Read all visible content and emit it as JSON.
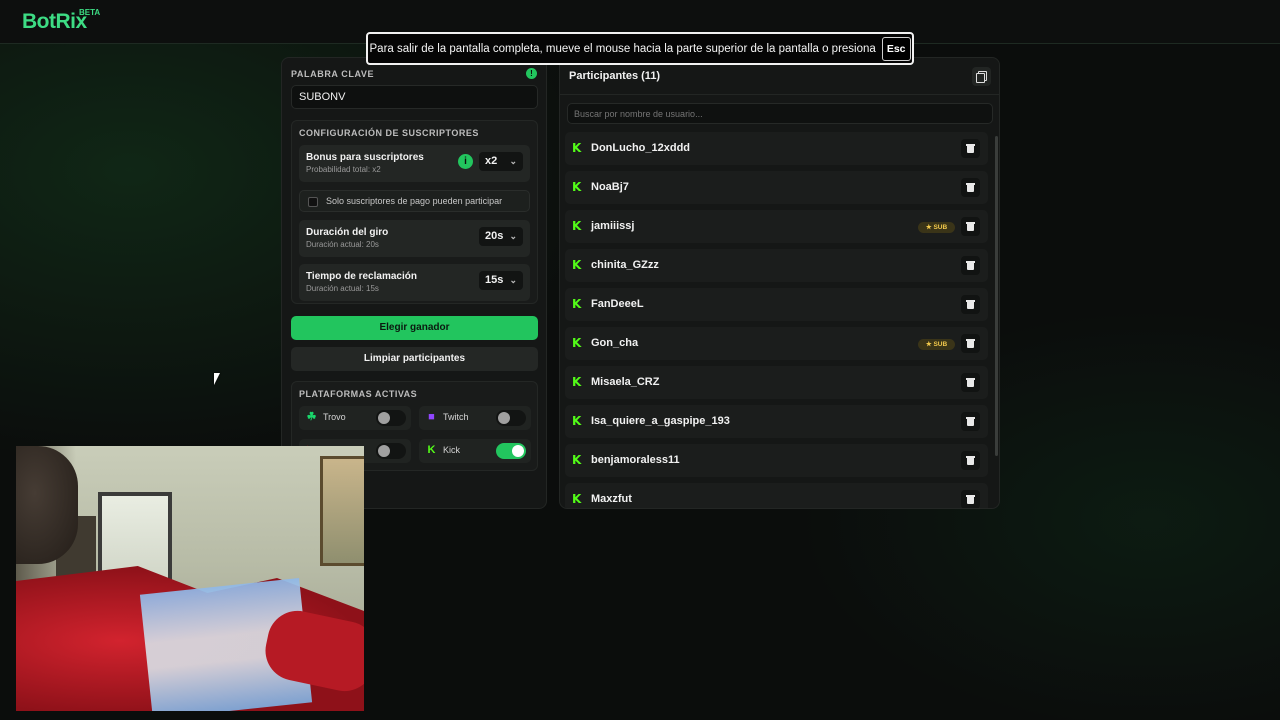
{
  "app": {
    "name": "BotRix",
    "badge": "BETA"
  },
  "fullscreen_toast": {
    "text": "Para salir de la pantalla completa, mueve el mouse hacia la parte superior de la pantalla o presiona",
    "key": "Esc"
  },
  "keyword": {
    "label": "PALABRA CLAVE",
    "value": "SUBONV"
  },
  "subscriber_config": {
    "title": "CONFIGURACIÓN DE SUSCRIPTORES",
    "bonus": {
      "title": "Bonus para suscriptores",
      "subtitle": "Probabilidad total: x2",
      "value": "x2"
    },
    "paid_only": {
      "label": "Solo suscriptores de pago pueden participar",
      "checked": false
    },
    "spin_duration": {
      "title": "Duración del giro",
      "subtitle": "Duración actual: 20s",
      "value": "20s"
    },
    "claim_time": {
      "title": "Tiempo de reclamación",
      "subtitle": "Duración actual: 15s",
      "value": "15s"
    }
  },
  "buttons": {
    "pick_winner": "Elegir ganador",
    "clear_participants": "Limpiar participantes"
  },
  "platforms": {
    "title": "PLATAFORMAS ACTIVAS",
    "items": [
      {
        "name": "Trovo",
        "enabled": false,
        "color": "#19d66b"
      },
      {
        "name": "Twitch",
        "enabled": false,
        "color": "#9146ff"
      },
      {
        "name": "",
        "enabled": false,
        "color": "#ff0000"
      },
      {
        "name": "Kick",
        "enabled": true,
        "color": "#53fc18"
      }
    ]
  },
  "participants": {
    "title": "Participantes (11)",
    "search_placeholder": "Buscar por nombre de usuario...",
    "sub_badge": "SUB",
    "items": [
      {
        "name": "DonLucho_12xddd",
        "sub": false
      },
      {
        "name": "NoaBj7",
        "sub": false
      },
      {
        "name": "jamiiissj",
        "sub": true
      },
      {
        "name": "chinita_GZzz",
        "sub": false
      },
      {
        "name": "FanDeeeL",
        "sub": false
      },
      {
        "name": "Gon_cha",
        "sub": true
      },
      {
        "name": "Misaela_CRZ",
        "sub": false
      },
      {
        "name": "Isa_quiere_a_gaspipe_193",
        "sub": false
      },
      {
        "name": "benjamoraless11",
        "sub": false
      },
      {
        "name": "Maxzfut",
        "sub": false
      }
    ]
  },
  "colors": {
    "accent": "#22c55e",
    "kick": "#53fc18",
    "sub_badge": "#f2c94c"
  }
}
